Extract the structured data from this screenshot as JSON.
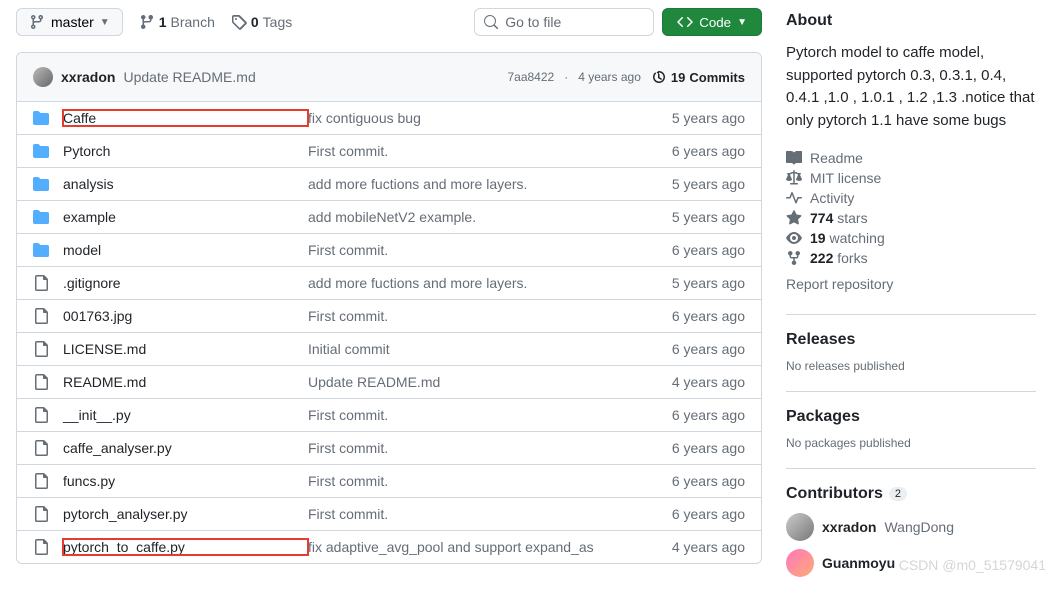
{
  "toolbar": {
    "branch": "master",
    "branches_count": "1",
    "branches_label": "Branch",
    "tags_count": "0",
    "tags_label": "Tags",
    "search_placeholder": "Go to file",
    "code_label": "Code"
  },
  "header": {
    "author": "xxradon",
    "message": "Update README.md",
    "sha": "7aa8422",
    "time": "4 years ago",
    "commits_count": "19",
    "commits_label": "Commits"
  },
  "files": [
    {
      "name": "Caffe",
      "type": "dir",
      "msg": "fix contiguous bug",
      "age": "5 years ago",
      "hl": true
    },
    {
      "name": "Pytorch",
      "type": "dir",
      "msg": "First commit.",
      "age": "6 years ago"
    },
    {
      "name": "analysis",
      "type": "dir",
      "msg": "add more fuctions and more layers.",
      "age": "5 years ago"
    },
    {
      "name": "example",
      "type": "dir",
      "msg": "add mobileNetV2 example.",
      "age": "5 years ago"
    },
    {
      "name": "model",
      "type": "dir",
      "msg": "First commit.",
      "age": "6 years ago"
    },
    {
      "name": ".gitignore",
      "type": "file",
      "msg": "add more fuctions and more layers.",
      "age": "5 years ago"
    },
    {
      "name": "001763.jpg",
      "type": "file",
      "msg": "First commit.",
      "age": "6 years ago"
    },
    {
      "name": "LICENSE.md",
      "type": "file",
      "msg": "Initial commit",
      "age": "6 years ago"
    },
    {
      "name": "README.md",
      "type": "file",
      "msg": "Update README.md",
      "age": "4 years ago"
    },
    {
      "name": "__init__.py",
      "type": "file",
      "msg": "First commit.",
      "age": "6 years ago"
    },
    {
      "name": "caffe_analyser.py",
      "type": "file",
      "msg": "First commit.",
      "age": "6 years ago"
    },
    {
      "name": "funcs.py",
      "type": "file",
      "msg": "First commit.",
      "age": "6 years ago"
    },
    {
      "name": "pytorch_analyser.py",
      "type": "file",
      "msg": "First commit.",
      "age": "6 years ago"
    },
    {
      "name": "pytorch_to_caffe.py",
      "type": "file",
      "msg": "fix adaptive_avg_pool and support expand_as",
      "age": "4 years ago",
      "hl": true
    }
  ],
  "about": {
    "title": "About",
    "description": "Pytorch model to caffe model, supported pytorch 0.3, 0.3.1, 0.4, 0.4.1 ,1.0 , 1.0.1 , 1.2 ,1.3 .notice that only pytorch 1.1 have some bugs",
    "readme": "Readme",
    "license": "MIT license",
    "activity": "Activity",
    "stars_n": "774",
    "stars_l": "stars",
    "watch_n": "19",
    "watch_l": "watching",
    "forks_n": "222",
    "forks_l": "forks",
    "report": "Report repository"
  },
  "releases": {
    "title": "Releases",
    "empty": "No releases published"
  },
  "packages": {
    "title": "Packages",
    "empty": "No packages published"
  },
  "contributors": {
    "title": "Contributors",
    "count": "2",
    "list": [
      {
        "login": "xxradon",
        "name": "WangDong"
      },
      {
        "login": "Guanmoyu",
        "name": ""
      }
    ]
  },
  "watermark": "CSDN @m0_51579041"
}
